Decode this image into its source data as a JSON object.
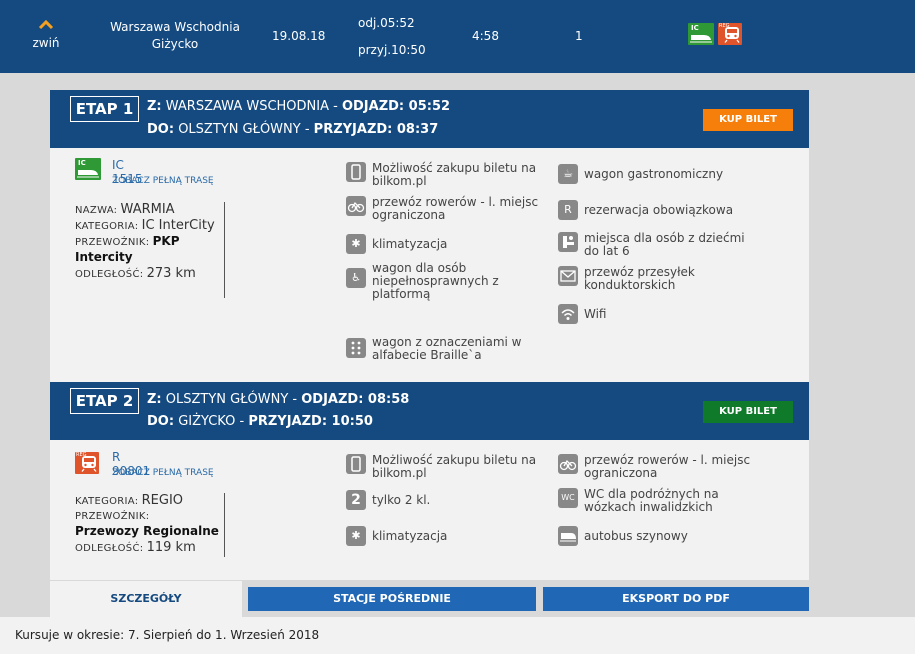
{
  "summary": {
    "collapse_label": "zwiń",
    "from": "Warszawa Wschodnia",
    "to": "Giżycko",
    "date": "19.08.18",
    "departure": "odj.05:52",
    "arrival": "przyj.10:50",
    "duration": "4:58",
    "changes": "1",
    "carrier_badges": [
      "IC",
      "REG"
    ]
  },
  "stages": [
    {
      "etap": "ETAP 1",
      "from_prefix": "Z:",
      "from": "WARSZAWA WSCHODNIA",
      "dep_label": "ODJAZD: 05:52",
      "to_prefix": "DO:",
      "to": "OLSZTYN GŁÓWNY",
      "arr_label": "PRZYJAZD: 08:37",
      "buy_label": "KUP BILET",
      "badge": "IC",
      "train_number": "IC 1515",
      "full_route_label": "ZOBACZ PEŁNĄ TRASĘ",
      "name_label": "NAZWA:",
      "name": "WARMIA",
      "category_label": "KATEGORIA:",
      "category": "IC InterCity",
      "carrier_label": "PRZEWOŹNIK:",
      "carrier": "PKP Intercity",
      "distance_label": "ODLEGŁOŚĆ:",
      "distance": "273 km",
      "features_left": [
        {
          "icon": "phone-icon",
          "text": "Możliwość zakupu biletu na bilkom.pl"
        },
        {
          "icon": "bicycle-icon",
          "text": "przewóz rowerów - l. miejsc ograniczona"
        },
        {
          "icon": "snowflake-icon",
          "text": "klimatyzacja"
        },
        {
          "icon": "wheelchair-icon",
          "text": "wagon dla osób niepełnosprawnych z platformą"
        },
        {
          "icon": "braille-icon",
          "text": "wagon z oznaczeniami w alfabecie Braille`a"
        }
      ],
      "features_right": [
        {
          "icon": "coffee-cup-icon",
          "text": "wagon gastronomiczny"
        },
        {
          "icon": "reservation-r-icon",
          "text": "rezerwacja obowiązkowa"
        },
        {
          "icon": "children-seat-icon",
          "text": "miejsca dla osób z dziećmi do lat 6"
        },
        {
          "icon": "envelope-icon",
          "text": "przewóz przesyłek konduktorskich"
        },
        {
          "icon": "wifi-icon",
          "text": "Wifi"
        }
      ]
    },
    {
      "etap": "ETAP 2",
      "from_prefix": "Z:",
      "from": "OLSZTYN GŁÓWNY",
      "dep_label": "ODJAZD: 08:58",
      "to_prefix": "DO:",
      "to": "GIŻYCKO",
      "arr_label": "PRZYJAZD: 10:50",
      "buy_label": "KUP BILET",
      "badge": "REG",
      "train_number": "R 90801",
      "full_route_label": "ZOBACZ PEŁNĄ TRASĘ",
      "category_label": "KATEGORIA:",
      "category": "REGIO",
      "carrier_label": "PRZEWOŹNIK:",
      "carrier": "Przewozy Regionalne",
      "distance_label": "ODLEGŁOŚĆ:",
      "distance": "119 km",
      "features_left": [
        {
          "icon": "phone-icon",
          "text": "Możliwość zakupu biletu na bilkom.pl"
        },
        {
          "icon": "second-class-icon",
          "text": "tylko 2 kl."
        },
        {
          "icon": "snowflake-icon",
          "text": "klimatyzacja"
        }
      ],
      "features_right": [
        {
          "icon": "bicycle-icon",
          "text": "przewóz rowerów - l. miejsc ograniczona"
        },
        {
          "icon": "wc-icon",
          "text": "WC dla podróżnych na wózkach inwalidzkich"
        },
        {
          "icon": "railbus-icon",
          "text": "autobus szynowy"
        }
      ]
    }
  ],
  "tabs": {
    "details": "SZCZEGÓŁY",
    "stations": "STACJE POŚREDNIE",
    "pdf": "EKSPORT DO PDF"
  },
  "footer": "Kursuje w okresie: 7. Sierpień do 1. Wrzesień 2018",
  "colors": {
    "header_blue": "#154a80",
    "buy_orange": "#f57f0a",
    "buy_green": "#0e7a2a",
    "tab_blue": "#2068b5"
  }
}
